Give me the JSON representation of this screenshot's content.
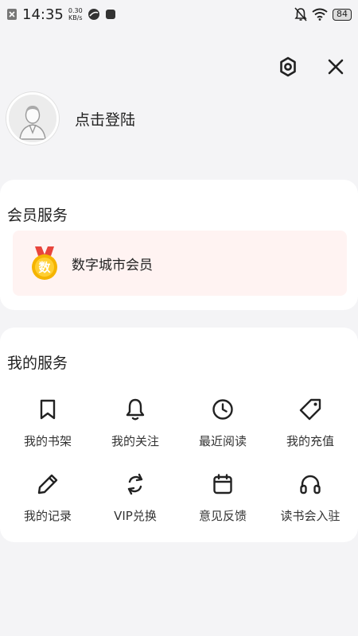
{
  "status_bar": {
    "time": "14:35",
    "net_speed_value": "0.30",
    "net_speed_unit": "KB/s",
    "battery": "84"
  },
  "profile": {
    "login_text": "点击登陆"
  },
  "member_section": {
    "title": "会员服务",
    "item_label": "数字城市会员",
    "medal_char": "数"
  },
  "services_section": {
    "title": "我的服务",
    "items": [
      {
        "label": "我的书架",
        "icon": "bookmark-icon"
      },
      {
        "label": "我的关注",
        "icon": "bell-icon"
      },
      {
        "label": "最近阅读",
        "icon": "clock-icon"
      },
      {
        "label": "我的充值",
        "icon": "tag-icon"
      },
      {
        "label": "我的记录",
        "icon": "pencil-icon"
      },
      {
        "label": "VIP兑换",
        "icon": "refresh-icon"
      },
      {
        "label": "意见反馈",
        "icon": "calendar-icon"
      },
      {
        "label": "读书会入驻",
        "icon": "headphones-icon"
      }
    ]
  },
  "colors": {
    "background": "#f4f4f6",
    "member_item_bg": "#fff3f2",
    "medal_gold": "#f5b400",
    "medal_ribbon": "#e8453c"
  }
}
